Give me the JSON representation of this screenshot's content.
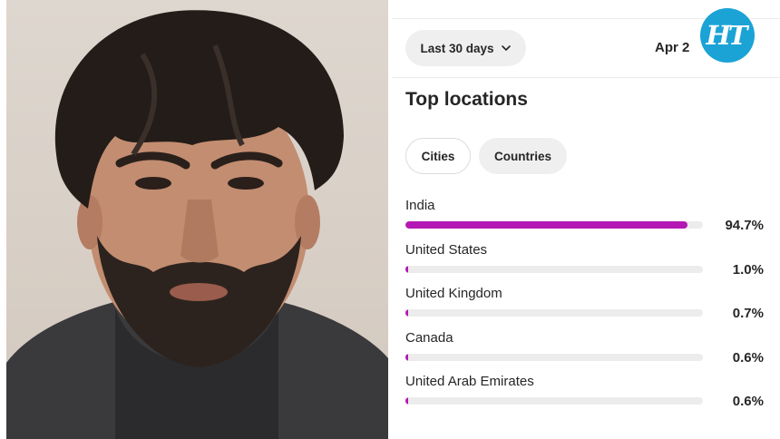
{
  "photo": {
    "description_icon": "portrait-photo"
  },
  "header": {
    "range_label": "Last 30 days",
    "range_icon": "chevron-down-icon",
    "date_label": "Apr 2",
    "logo_text": "HT",
    "logo_color": "#1ba3d6"
  },
  "section": {
    "title": "Top locations"
  },
  "tabs": [
    {
      "label": "Cities",
      "selected": true
    },
    {
      "label": "Countries",
      "selected": false
    }
  ],
  "accent_color": "#b418b4",
  "locations": [
    {
      "name": "India",
      "percent_label": "94.7%",
      "fraction": 0.947
    },
    {
      "name": "United States",
      "percent_label": "1.0%",
      "fraction": 0.01
    },
    {
      "name": "United Kingdom",
      "percent_label": "0.7%",
      "fraction": 0.007
    },
    {
      "name": "Canada",
      "percent_label": "0.6%",
      "fraction": 0.006
    },
    {
      "name": "United Arab Emirates",
      "percent_label": "0.6%",
      "fraction": 0.006
    }
  ]
}
